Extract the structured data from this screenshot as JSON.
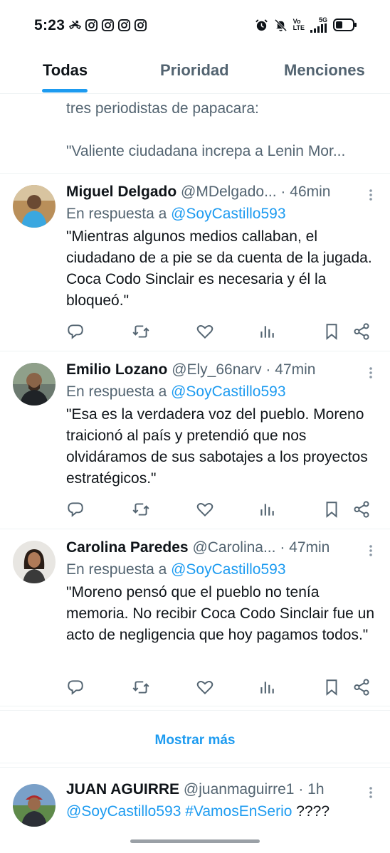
{
  "status_bar": {
    "time": "5:23",
    "left_icons": [
      "missed-call-icon",
      "instagram-icon",
      "instagram-icon",
      "instagram-icon",
      "instagram-icon"
    ],
    "right_icons": [
      "alarm-icon",
      "silent-icon",
      "volte-icon",
      "5g-signal-icon",
      "battery-icon"
    ],
    "net_top": "Vo",
    "net_bottom": "LTE",
    "net_5g": "5G"
  },
  "tabs": [
    {
      "label": "Todas",
      "active": true
    },
    {
      "label": "Prioridad",
      "active": false
    },
    {
      "label": "Menciones",
      "active": false
    }
  ],
  "partial_tweet": {
    "line1": "tres periodistas de papacara:",
    "line2": "\"Valiente ciudadana increpa a Lenin Mor..."
  },
  "replies": [
    {
      "name": "Miguel Delgado",
      "handle": "@MDelgado...",
      "sep": "·",
      "time": "46min",
      "replying_prefix": "En respuesta a",
      "replying_to": "@SoyCastillo593",
      "text": "\"Mientras algunos medios callaban, el ciudadano de a pie se da cuenta de la jugada. Coca Codo Sinclair es necesaria y él la bloqueó.\""
    },
    {
      "name": "Emilio Lozano",
      "handle": "@Ely_66narv",
      "sep": "·",
      "time": "47min",
      "replying_prefix": "En respuesta a",
      "replying_to": "@SoyCastillo593",
      "text": "\"Esa es la verdadera voz del pueblo. Moreno traicionó al país y pretendió que nos olvidáramos de sus sabotajes a los proyectos estratégicos.\""
    },
    {
      "name": "Carolina Paredes",
      "handle": "@Carolina...",
      "sep": "·",
      "time": "47min",
      "replying_prefix": "En respuesta a",
      "replying_to": "@SoyCastillo593",
      "text": "\"Moreno pensó que el pueblo no tenía memoria. No recibir Coca Codo Sinclair fue un acto de negligencia que hoy pagamos todos.\""
    }
  ],
  "show_more": "Mostrar más",
  "last_tweet": {
    "name": "JUAN AGUIRRE",
    "handle": "@juanmaguirre1",
    "sep": "·",
    "time": "1h",
    "mention": "@SoyCastillo593",
    "hashtag": "#VamosEnSerio",
    "suffix": " ????"
  },
  "colors": {
    "accent": "#1d9bf0",
    "text_primary": "#0f1419",
    "text_secondary": "#536471",
    "divider": "#eff3f4"
  }
}
